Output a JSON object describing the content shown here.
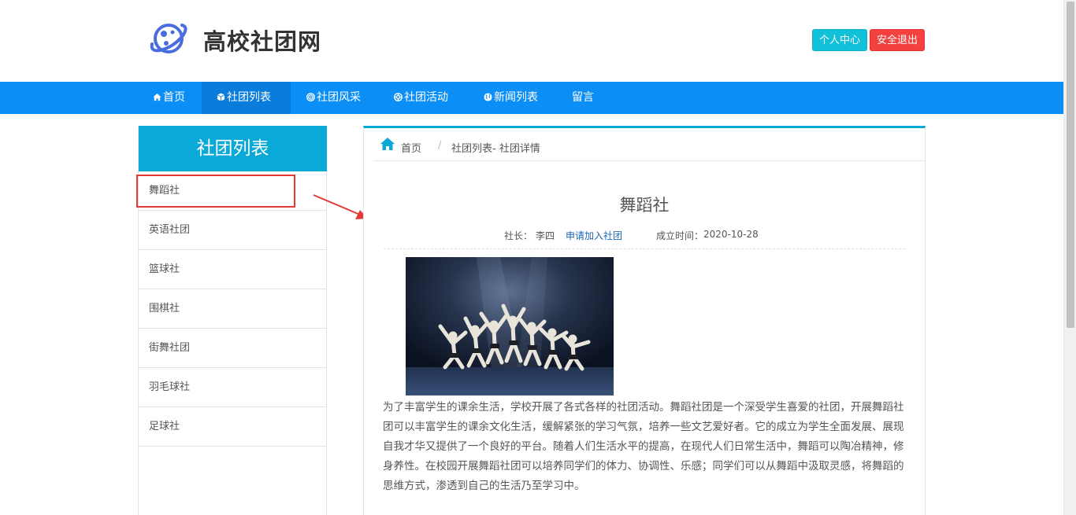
{
  "header": {
    "site_title": "高校社团网",
    "user_center_label": "个人中心",
    "logout_label": "安全退出"
  },
  "nav": {
    "items": [
      {
        "label": "首页",
        "icon": "home-icon"
      },
      {
        "label": "社团列表",
        "icon": "cube-icon"
      },
      {
        "label": "社团风采",
        "icon": "target-icon"
      },
      {
        "label": "社团活动",
        "icon": "lifebuoy-icon"
      },
      {
        "label": "新闻列表",
        "icon": "globe-icon"
      },
      {
        "label": "留言",
        "icon": ""
      }
    ],
    "active_index": 1
  },
  "sidebar": {
    "title": "社团列表",
    "items": [
      {
        "label": "舞蹈社"
      },
      {
        "label": "英语社团"
      },
      {
        "label": "篮球社"
      },
      {
        "label": "围棋社"
      },
      {
        "label": "街舞社团"
      },
      {
        "label": "羽毛球社"
      },
      {
        "label": "足球社"
      }
    ],
    "selected_index": 0
  },
  "breadcrumb": {
    "home": "首页",
    "separator": "/",
    "current": "社团列表- 社团详情"
  },
  "club": {
    "name": "舞蹈社",
    "leader_label": "社长：",
    "leader": "李四",
    "join_label": "申请加入社团",
    "date_label": "成立时间：",
    "date": "2020-10-28",
    "description": "为了丰富学生的课余生活，学校开展了各式各样的社团活动。舞蹈社团是一个深受学生喜爱的社团，开展舞蹈社团可以丰富学生的课余文化生活，缓解紧张的学习气氛，培养一些文艺爱好者。它的成立为学生全面发展、展现自我才华又提供了一个良好的平台。随着人们生活水平的提高，在现代人们日常生活中，舞蹈可以陶冶精神，修身养性。在校园开展舞蹈社团可以培养同学们的体力、协调性、乐感；同学们可以从舞蹈中汲取灵感，将舞蹈的思维方式，渗透到自己的生活乃至学习中。"
  },
  "colors": {
    "nav_bg": "#0b8ef5",
    "nav_active": "#0a7ddc",
    "accent": "#0ba9d8",
    "btn_user": "#11c1d9",
    "btn_logout": "#f2413f",
    "highlight": "#e23b36",
    "link": "#1b66b5"
  }
}
